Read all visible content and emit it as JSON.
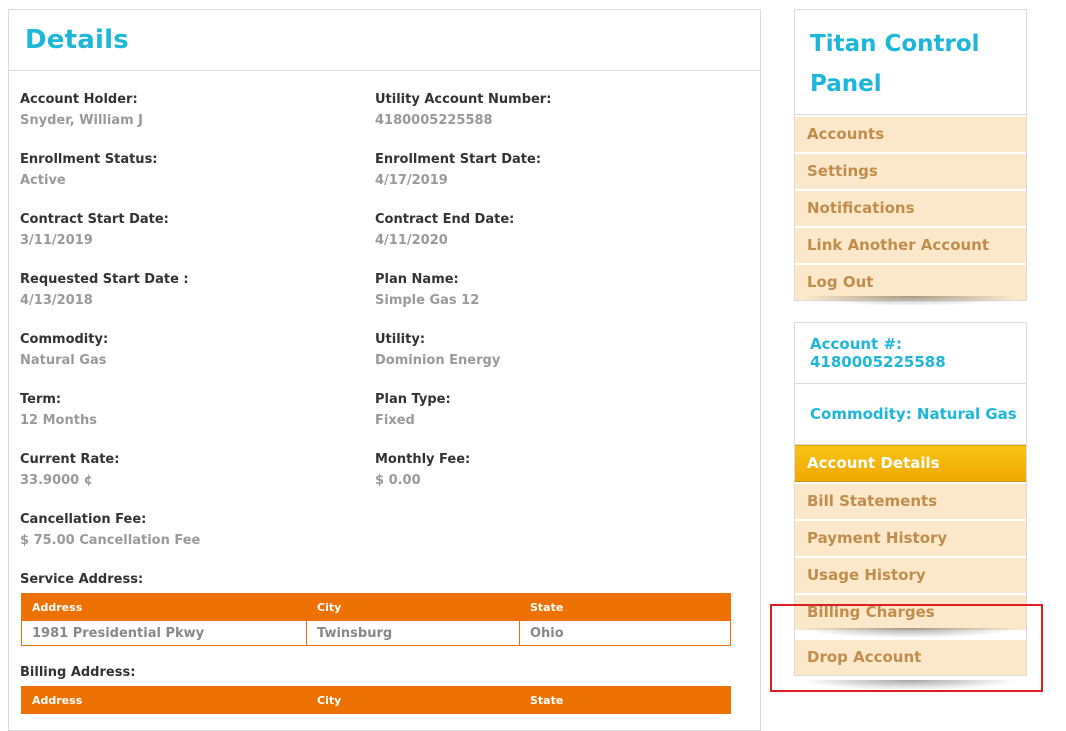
{
  "details": {
    "title": "Details",
    "fields": [
      {
        "label": "Account Holder:",
        "value": "Snyder, William J"
      },
      {
        "label": "Utility Account Number:",
        "value": "4180005225588"
      },
      {
        "label": "Enrollment Status:",
        "value": "Active"
      },
      {
        "label": "Enrollment Start Date:",
        "value": "4/17/2019"
      },
      {
        "label": "Contract Start Date:",
        "value": "3/11/2019"
      },
      {
        "label": "Contract End Date:",
        "value": "4/11/2020"
      },
      {
        "label": "Requested Start Date :",
        "value": "4/13/2018"
      },
      {
        "label": "Plan Name:",
        "value": "Simple Gas 12"
      },
      {
        "label": "Commodity:",
        "value": "Natural Gas"
      },
      {
        "label": "Utility:",
        "value": "Dominion Energy"
      },
      {
        "label": "Term:",
        "value": "12 Months"
      },
      {
        "label": "Plan Type:",
        "value": "Fixed"
      },
      {
        "label": "Current Rate:",
        "value": "33.9000 ¢"
      },
      {
        "label": "Monthly Fee:",
        "value": "$ 0.00"
      },
      {
        "label": "Cancellation Fee:",
        "value": "$ 75.00 Cancellation Fee"
      }
    ],
    "service_address": {
      "label": "Service Address:",
      "headers": [
        "Address",
        "City",
        "State"
      ],
      "row": [
        "1981 Presidential Pkwy",
        "Twinsburg",
        "Ohio"
      ]
    },
    "billing_address": {
      "label": "Billing Address:",
      "headers": [
        "Address",
        "City",
        "State"
      ]
    }
  },
  "control_panel": {
    "title": "Titan Control Panel",
    "items": [
      "Accounts",
      "Settings",
      "Notifications",
      "Link Another Account",
      "Log Out"
    ]
  },
  "account_panel": {
    "account_number": "Account #: 4180005225588",
    "commodity": "Commodity: Natural Gas",
    "items": [
      "Account Details",
      "Bill Statements",
      "Payment History",
      "Usage History",
      "Billing Charges",
      "Drop Account"
    ],
    "active_index": 0
  },
  "colors": {
    "accent_blue": "#1eb6d9",
    "table_orange": "#ee7203",
    "menu_bg": "#fbe8cb",
    "menu_text": "#c08d4c",
    "active_gold": "#f8c316",
    "highlight_red": "#e02020"
  }
}
